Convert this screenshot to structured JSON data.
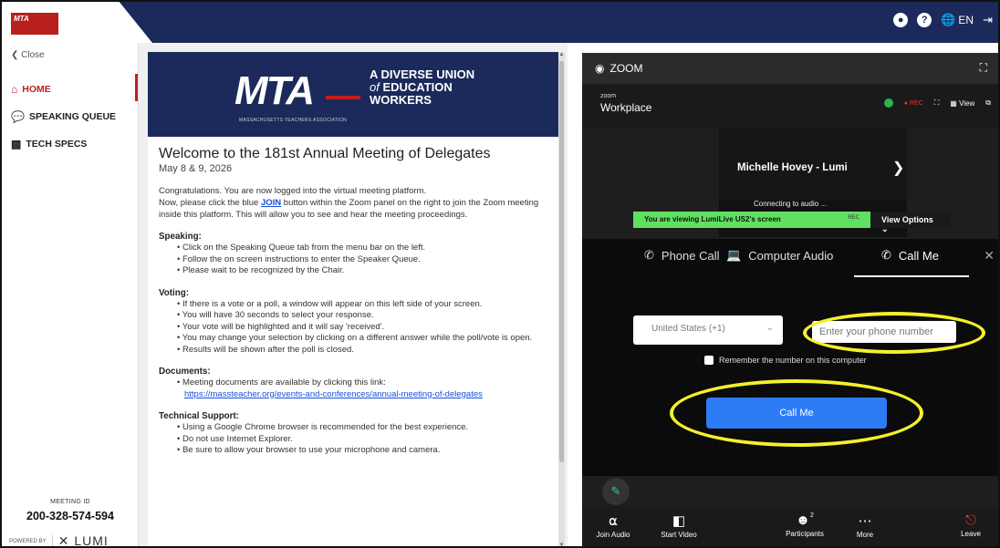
{
  "header": {
    "logo_text": "MTA",
    "user_icon": "user-circle-icon",
    "help_icon": "help-icon",
    "language": "EN",
    "language_icon": "globe-icon",
    "logout_icon": "logout-icon",
    "bg_color": "#1b2a5a"
  },
  "sidebar": {
    "close_label": "Close",
    "items": [
      {
        "label": "HOME",
        "icon": "home-icon",
        "active": true
      },
      {
        "label": "SPEAKING QUEUE",
        "icon": "speaking-queue-icon",
        "active": false
      },
      {
        "label": "TECH SPECS",
        "icon": "tech-specs-icon",
        "active": false
      }
    ],
    "meeting_id_label": "MEETING ID",
    "meeting_id": "200-328-574-594",
    "powered_by": "POWERED BY",
    "lumi": "LUMI",
    "accent_color": "#c11f1f"
  },
  "banner": {
    "logo": "MTA",
    "logo_sub": "MASSACHUSETTS TEACHERS ASSOCIATION",
    "line1": "A DIVERSE UNION",
    "line2_italic": "of",
    "line2": "EDUCATION",
    "line3": "WORKERS"
  },
  "doc": {
    "title": "Welcome to the 181st Annual Meeting of Delegates",
    "date": "May 8 & 9, 2026",
    "intro_1": "Congratulations. You are now logged into the virtual meeting platform.",
    "intro_2a": "Now, please click the blue",
    "intro_join": "JOIN",
    "intro_2b": "button within the Zoom panel on the right to join the Zoom meeting inside this platform. This will allow you to see and hear the meeting proceedings.",
    "speaking_heading": "Speaking:",
    "speaking_items": [
      "Click on the Speaking Queue tab from the menu bar on the left.",
      "Follow the on screen instructions to enter the Speaker Queue.",
      "Please wait to be recognized by the Chair."
    ],
    "voting_heading": "Voting:",
    "voting_items": [
      "If there is a vote or a poll, a window will appear on this left side of your screen.",
      "You will have 30 seconds to select your response.",
      "Your vote will be highlighted and it will say 'received'.",
      "You may change your selection by clicking on a different answer while the poll/vote is open.",
      "Results will be shown after the poll is closed."
    ],
    "documents_heading": "Documents:",
    "documents_item": "Meeting documents are available by clicking this link:",
    "documents_link": "https://massteacher.org/events-and-conferences/annual-meeting-of-delegates",
    "support_heading": "Technical Support:",
    "support_items": [
      "Using a Google Chrome browser is recommended for the best experience.",
      "Do not use Internet Explorer.",
      "Be sure to allow your browser to use your microphone and camera."
    ]
  },
  "zoom": {
    "title": "ZOOM",
    "workplace_small": "zoom",
    "workplace": "Workplace",
    "rec_label": "REC",
    "view_label": "View",
    "participant_name": "Michelle Hovey - Lumi",
    "connecting": "Connecting to audio ...",
    "viewing_text": "You are viewing LumiLive US2's screen",
    "viewing_rec": "REC",
    "view_options": "View Options",
    "tabs": [
      {
        "label": "Phone Call",
        "icon": "phone-call-icon"
      },
      {
        "label": "Computer Audio",
        "icon": "computer-audio-icon"
      },
      {
        "label": "Call Me",
        "icon": "call-me-icon"
      }
    ],
    "active_tab": "Call Me",
    "country": "United States (+1)",
    "phone_placeholder": "Enter your phone number",
    "remember_label": "Remember the number on this computer",
    "call_me_button": "Call Me",
    "highlight_color": "#f5f02a",
    "button_color": "#2d7cf6",
    "toolbar": [
      {
        "label": "Join Audio",
        "icon": "headphones-icon"
      },
      {
        "label": "Start Video",
        "icon": "video-off-icon"
      },
      {
        "label": "Participants",
        "icon": "participants-icon",
        "count": "2"
      },
      {
        "label": "More",
        "icon": "more-icon"
      },
      {
        "label": "Leave",
        "icon": "leave-icon"
      }
    ]
  }
}
